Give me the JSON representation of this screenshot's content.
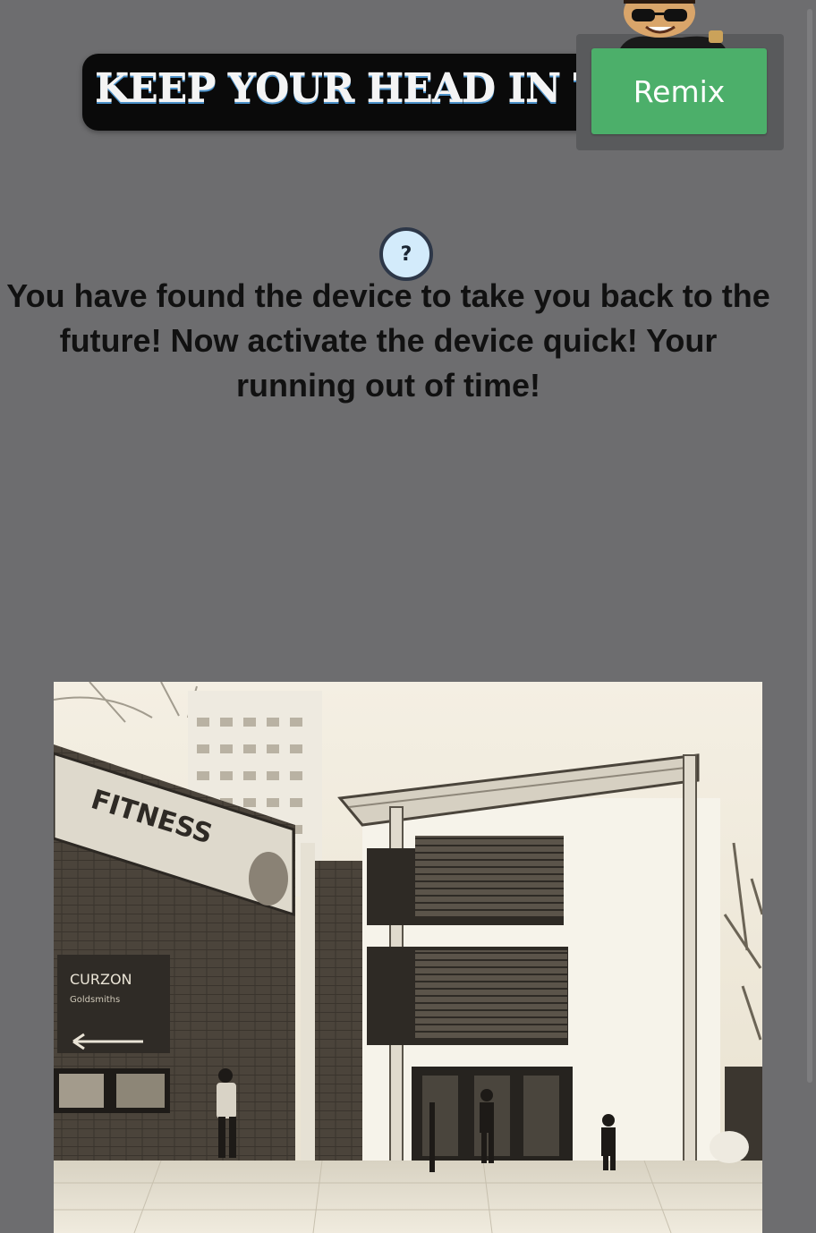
{
  "header": {
    "title": "KEEP YOUR HEAD IN THE GAME"
  },
  "toolbar": {
    "remix_label": "Remix"
  },
  "help": {
    "label": "?"
  },
  "story": {
    "message": "You have found the device to take you back to the future! Now activate the device quick! Your running out of time!"
  },
  "photo": {
    "banner_text": "FITNESS",
    "sign_title": "CURZON",
    "sign_subtitle": "Goldsmiths"
  },
  "colors": {
    "background": "#6d6d6f",
    "remix_green": "#4caf6a",
    "help_bubble": "#d3ebfb",
    "banner_black": "#0a0a0a"
  },
  "icons": {
    "avatar": "avatar-sunglasses",
    "help": "question-mark-icon"
  }
}
